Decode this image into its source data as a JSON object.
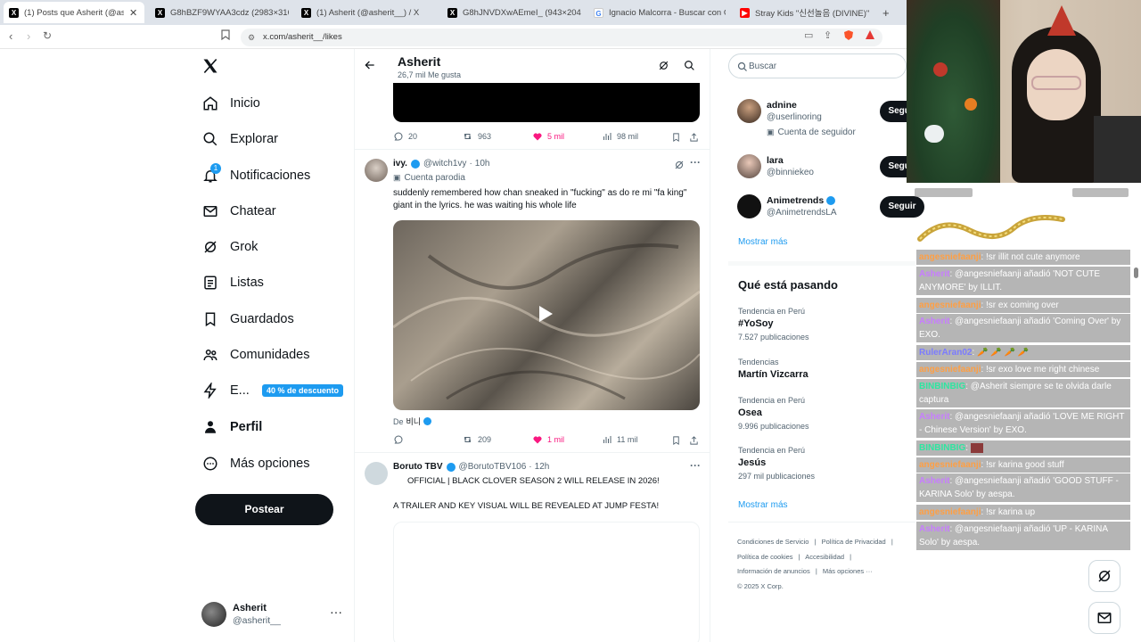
{
  "browser": {
    "tabs": [
      {
        "title": "(1) Posts que Asherit (@asherit_",
        "icon": "x-icon",
        "active": true
      },
      {
        "title": "G8hBZF9WYAA3cdz (2983×3160)",
        "icon": "x-icon"
      },
      {
        "title": "(1) Asherit (@asherit__) / X",
        "icon": "x-icon"
      },
      {
        "title": "G8hJNVDXwAEmeI_ (943×2048)",
        "icon": "x-icon"
      },
      {
        "title": "Ignacio Malcorra - Buscar con Googl",
        "icon": "google-icon"
      },
      {
        "title": "Stray Kids \"신선놀음 (DIVINE)\" M",
        "icon": "youtube-icon"
      }
    ],
    "url": "x.com/asherit__/likes"
  },
  "sidebar": {
    "items": [
      {
        "label": "Inicio",
        "icon": "home-icon"
      },
      {
        "label": "Explorar",
        "icon": "search-icon"
      },
      {
        "label": "Notificaciones",
        "icon": "bell-icon",
        "badge": "1"
      },
      {
        "label": "Chatear",
        "icon": "mail-icon"
      },
      {
        "label": "Grok",
        "icon": "grok-icon"
      },
      {
        "label": "Listas",
        "icon": "list-icon"
      },
      {
        "label": "Guardados",
        "icon": "bookmark-icon"
      },
      {
        "label": "Comunidades",
        "icon": "communities-icon"
      },
      {
        "label": "E...",
        "icon": "lightning-icon",
        "promo": "40 % de descuento"
      },
      {
        "label": "Perfil",
        "icon": "person-icon"
      },
      {
        "label": "Más opciones",
        "icon": "more-circle-icon"
      }
    ],
    "post_button": "Postear",
    "account": {
      "name": "Asherit",
      "handle": "@asherit__"
    }
  },
  "header": {
    "title": "Asherit",
    "subtitle": "26,7 mil Me gusta"
  },
  "posts": [
    {
      "stats": {
        "replies": "20",
        "reposts": "963",
        "likes": "5 mil",
        "views": "98 mil"
      }
    },
    {
      "name": "ivy.",
      "handle": "@witch1vy",
      "time": "10h",
      "label": "Cuenta parodia",
      "text": "suddenly remembered how chan sneaked in \"fucking\" as do re mi \"fa king\" giant in the lyrics. he  was waiting his whole life",
      "from_label": "De",
      "from_name": "비니",
      "stats": {
        "replies": "",
        "reposts": "209",
        "likes": "1 mil",
        "views": "11 mil"
      }
    },
    {
      "name": "Boruto TBV",
      "handle": "@BorutoTBV106",
      "time": "12h",
      "line1": "OFFICIAL | BLACK CLOVER SEASON 2 WILL RELEASE IN 2026!",
      "line2": "A TRAILER AND KEY VISUAL WILL BE REVEALED AT JUMP FESTA!"
    }
  ],
  "right": {
    "search_placeholder": "Buscar",
    "follow": [
      {
        "name": "adnine",
        "handle": "@userlinoring",
        "note": "Cuenta de seguidor",
        "button": "Seguir"
      },
      {
        "name": "lara",
        "handle": "@binniekeo",
        "button": "Seguir"
      },
      {
        "name": "Animetrends",
        "handle": "@AnimetrendsLA",
        "button": "Seguir",
        "verified": true
      }
    ],
    "show_more": "Mostrar más",
    "trends_title": "Qué está pasando",
    "trends": [
      {
        "context": "Tendencia en Perú",
        "name": "#YoSoy",
        "count": "7.527 publicaciones"
      },
      {
        "context": "Tendencias",
        "name": "Martín Vizcarra",
        "count": ""
      },
      {
        "context": "Tendencia en Perú",
        "name": "Osea",
        "count": "9.996 publicaciones"
      },
      {
        "context": "Tendencia en Perú",
        "name": "Jesús",
        "count": "297 mil publicaciones"
      }
    ],
    "show_more2": "Mostrar más",
    "footer": {
      "l1a": "Condiciones de Servicio",
      "l1b": "Política de Privacidad",
      "l2a": "Política de cookies",
      "l2b": "Accesibilidad",
      "l3a": "Información de anuncios",
      "l3b": "Más opciones ···",
      "copy": "© 2025 X Corp."
    }
  },
  "chat": [
    {
      "name": "angesniefaanji",
      "msg": ": !sr illit not cute anymore",
      "color": "#ff9f43"
    },
    {
      "name": "Asherit",
      "msg": ": @angesniefaanji añadió 'NOT CUTE ANYMORE' by ILLIT.",
      "color": "#c77dff"
    },
    {
      "name": "angesniefaanji",
      "msg": ": !sr ex coming over",
      "color": "#ff9f43"
    },
    {
      "name": "Asherit",
      "msg": ": @angesniefaanji añadió 'Coming Over' by EXO.",
      "color": "#c77dff"
    },
    {
      "name": "RulerAran02",
      "msg": ": 🥕 🥕 🥕 🥕",
      "color": "#7b7bff"
    },
    {
      "name": "angesniefaanji",
      "msg": ": !sr exo love me right chinese",
      "color": "#ff9f43"
    },
    {
      "name": "BINBINBIG",
      "msg": ": @Asherit siempre se te olvida darle captura",
      "color": "#2ee6a0"
    },
    {
      "name": "Asherit",
      "msg": ": @angesniefaanji añadió 'LOVE ME RIGHT - Chinese Version' by EXO.",
      "color": "#c77dff"
    },
    {
      "name": "BINBINBIG",
      "msg": ": ",
      "color": "#2ee6a0"
    },
    {
      "name": "angesniefaanji",
      "msg": ": !sr karina good stuff",
      "color": "#ff9f43"
    },
    {
      "name": "Asherit",
      "msg": ": @angesniefaanji añadió 'GOOD STUFF - KARINA Solo' by aespa.",
      "color": "#c77dff"
    },
    {
      "name": "angesniefaanji",
      "msg": ": !sr karina up",
      "color": "#ff9f43"
    },
    {
      "name": "Asherit",
      "msg": ": @angesniefaanji añadió 'UP - KARINA Solo' by aespa.",
      "color": "#c77dff"
    }
  ],
  "colors": {
    "accent": "#1d9bf0",
    "like": "#f91880",
    "promo": "#1d9bf0"
  }
}
